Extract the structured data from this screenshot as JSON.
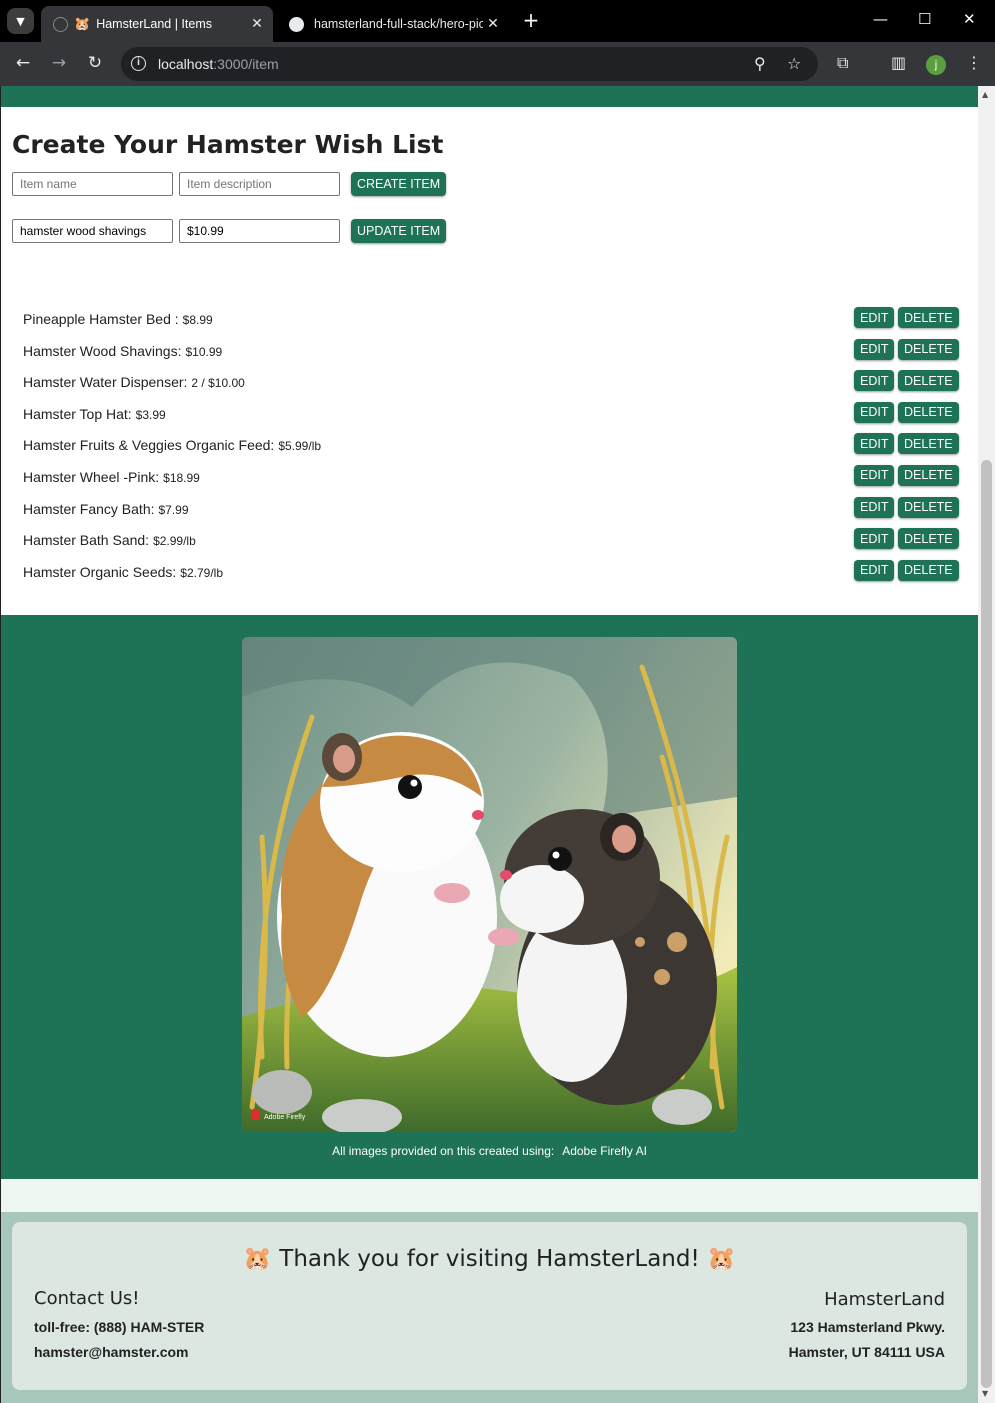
{
  "browser": {
    "tabs": [
      {
        "favicon": "hamster-emoji",
        "title": "HamsterLand | Items",
        "active": true
      },
      {
        "favicon": "github-icon",
        "title": "hamsterland-full-stack/hero-pic",
        "active": false
      }
    ],
    "url_host": "localhost",
    "url_path": ":3000/item",
    "profile_initial": "j"
  },
  "page": {
    "title": "Create Your Hamster Wish List",
    "create_form": {
      "name_placeholder": "Item name",
      "description_placeholder": "Item description",
      "create_label": "CREATE ITEM"
    },
    "update_form": {
      "name_value": "hamster wood shavings",
      "price_value": "$10.99",
      "update_label": "UPDATE ITEM"
    },
    "edit_label": "EDIT",
    "delete_label": "DELETE",
    "items": [
      {
        "name": "Pineapple Hamster Bed :",
        "price": "$8.99"
      },
      {
        "name": "Hamster Wood Shavings:",
        "price": "$10.99"
      },
      {
        "name": "Hamster Water Dispenser:",
        "price": "2 / $10.00"
      },
      {
        "name": "Hamster Top Hat:",
        "price": "$3.99"
      },
      {
        "name": "Hamster Fruits & Veggies Organic Feed:",
        "price": "$5.99/lb"
      },
      {
        "name": "Hamster Wheel -Pink:",
        "price": "$18.99"
      },
      {
        "name": "Hamster Fancy Bath:",
        "price": "$7.99"
      },
      {
        "name": "Hamster Bath Sand:",
        "price": "$2.99/lb"
      },
      {
        "name": "Hamster Organic Seeds:",
        "price": "$2.79/lb"
      }
    ],
    "hero_watermark": "Adobe Firefly",
    "credit_text": "All images provided on this created using:",
    "credit_link": "Adobe Firefly AI"
  },
  "footer": {
    "thanks": "🐹 Thank you for visiting HamsterLand! 🐹",
    "contact_heading": "Contact Us!",
    "phone": "toll-free: (888) HAM-STER",
    "email": "hamster@hamster.com",
    "brand": "HamsterLand",
    "address1": "123 Hamsterland Pkwy.",
    "address2": "Hamster, UT 84111 USA"
  },
  "colors": {
    "brand_green": "#1e7356",
    "footer_outer": "#a7c7ba",
    "footer_card": "#dce7e2"
  }
}
